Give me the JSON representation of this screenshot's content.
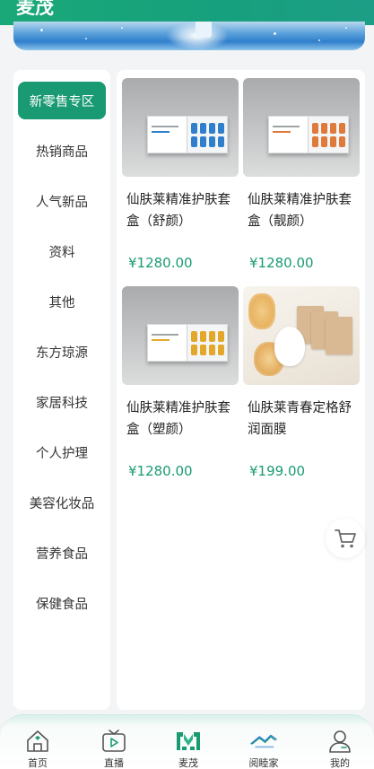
{
  "header": {
    "title": "麦茂"
  },
  "sidebar": {
    "items": [
      {
        "label": "新零售专区",
        "active": true
      },
      {
        "label": "热销商品"
      },
      {
        "label": "人气新品"
      },
      {
        "label": "资料"
      },
      {
        "label": "其他"
      },
      {
        "label": "东方琼源"
      },
      {
        "label": "家居科技"
      },
      {
        "label": "个人护理"
      },
      {
        "label": "美容化妆品"
      },
      {
        "label": "营养食品"
      },
      {
        "label": "保健食品"
      }
    ]
  },
  "products": [
    {
      "name": "仙肤莱精准护肤套盒（舒颜）",
      "price": "¥1280.00",
      "accent": "#2f7fcc"
    },
    {
      "name": "仙肤莱精准护肤套盒（靓颜）",
      "price": "¥1280.00",
      "accent": "#e07a3a"
    },
    {
      "name": "仙肤莱精准护肤套盒（塑颜）",
      "price": "¥1280.00",
      "accent": "#e3a72a"
    },
    {
      "name": "仙肤莱青春定格舒润面膜",
      "price": "¥199.00",
      "accent": "#d9b993"
    }
  ],
  "cart": {
    "icon": "cart-icon"
  },
  "tabbar": {
    "tabs": [
      {
        "label": "首页",
        "icon": "home-icon"
      },
      {
        "label": "直播",
        "icon": "live-tv-icon"
      },
      {
        "label": "麦茂",
        "icon": "maimao-logo-icon",
        "active": true
      },
      {
        "label": "阅睦家",
        "icon": "house-roof-icon"
      },
      {
        "label": "我的",
        "icon": "profile-icon"
      }
    ]
  },
  "colors": {
    "brand": "#1a9a73",
    "price": "#1a9a73"
  }
}
